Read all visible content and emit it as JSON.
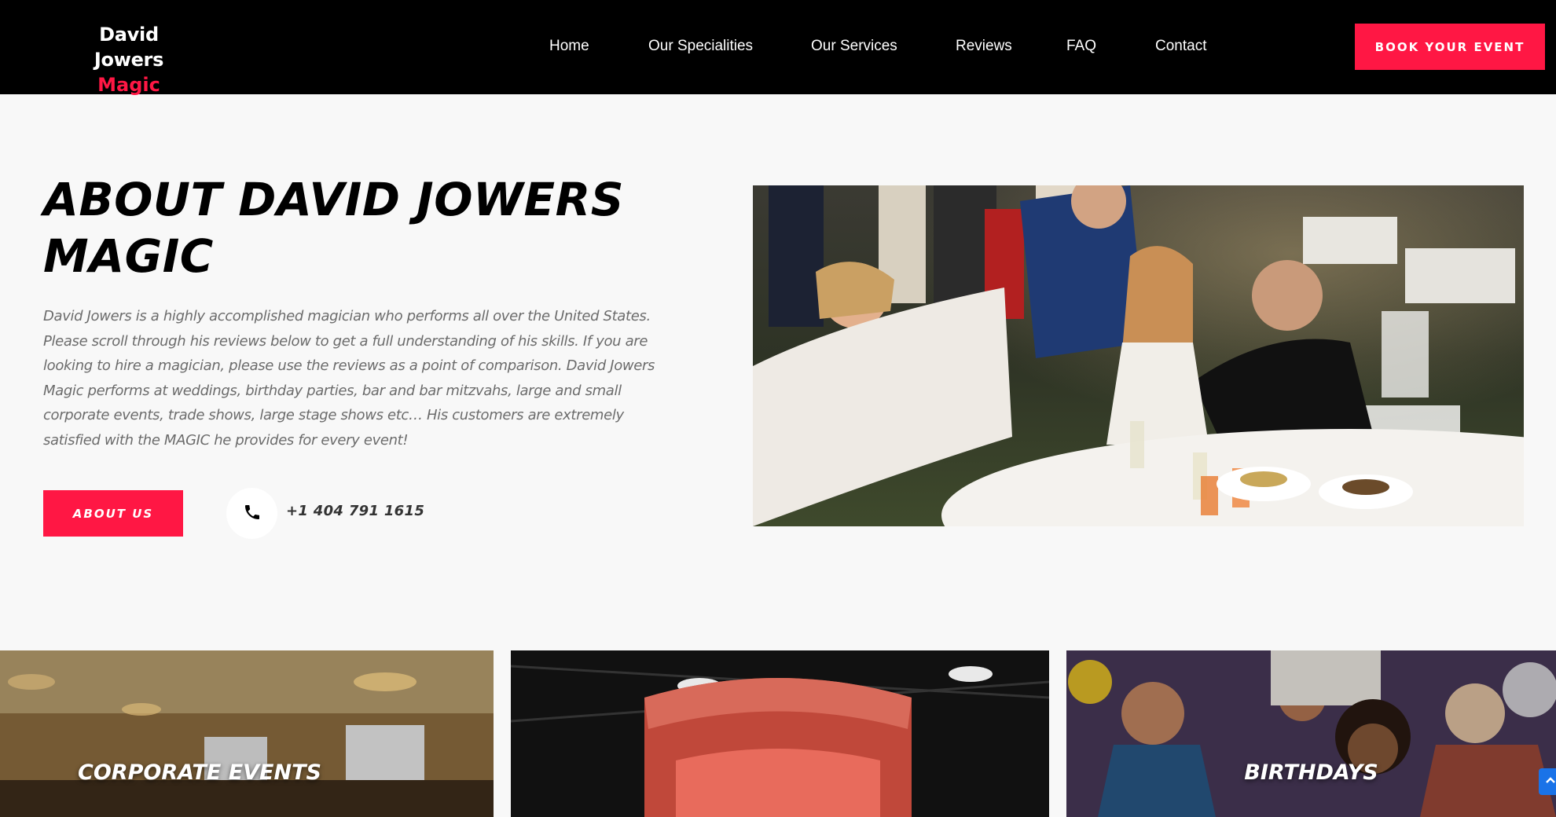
{
  "header": {
    "logo_line1": "David Jowers",
    "logo_line2": "Magic",
    "nav": [
      "Home",
      "Our Specialities",
      "Our Services",
      "Reviews",
      "FAQ",
      "Contact"
    ],
    "book_button": "BOOK YOUR EVENT"
  },
  "about": {
    "title": "ABOUT DAVID JOWERS MAGIC",
    "text": "David Jowers is a highly accomplished magician who performs all over the United States. Please scroll through his reviews below to get a full understanding of his skills.  If you are looking to hire a magician, please use the reviews as a point of comparison.  David Jowers Magic performs at weddings, birthday parties, bar and bar mitzvahs, large and small corporate events, trade shows, large stage shows etc… His customers are extremely satisfied with the  MAGIC he provides for every event!",
    "button": "ABOUT US",
    "phone": "+1 404 791 1615"
  },
  "cards": [
    {
      "label": "CORPORATE EVENTS"
    },
    {
      "label": ""
    },
    {
      "label": "BIRTHDAYS"
    }
  ],
  "icons": {
    "phone": "phone-icon",
    "scroll_top": "chevron-up-icon"
  },
  "colors": {
    "accent": "#ff1744",
    "header_bg": "#000000",
    "page_bg": "#f8f8f8"
  }
}
